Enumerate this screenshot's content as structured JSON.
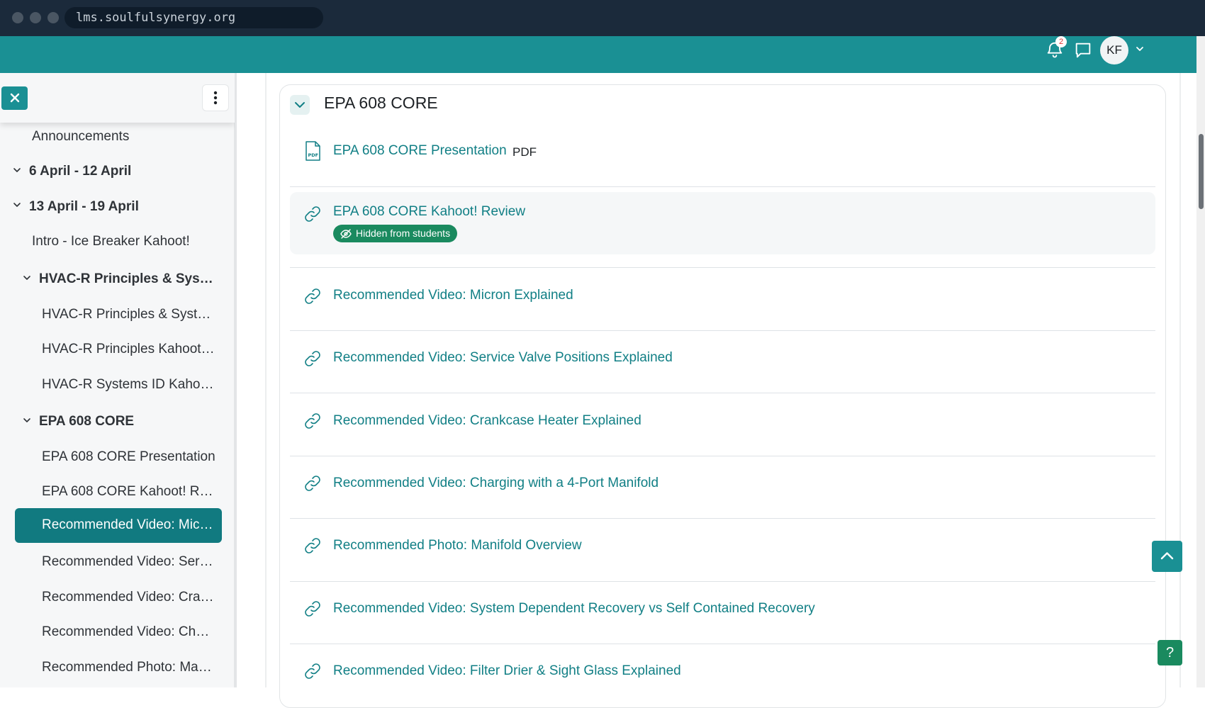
{
  "browser": {
    "url": "lms.soulfulsynergy.org"
  },
  "topbar": {
    "notification_count": "2",
    "avatar_initials": "KF",
    "icons": [
      "bell-icon",
      "chat-icon",
      "chevron-down-icon"
    ]
  },
  "sidebar": {
    "items": [
      {
        "label": "Announcements",
        "kind": "item"
      },
      {
        "label": "6 April - 12 April",
        "kind": "section"
      },
      {
        "label": "13 April - 19 April",
        "kind": "section"
      },
      {
        "label": "Intro - Ice Breaker Kahoot!",
        "kind": "item"
      },
      {
        "label": "HVAC-R Principles & Sys…",
        "kind": "subsection"
      },
      {
        "label": "HVAC-R Principles & Syst…",
        "kind": "item"
      },
      {
        "label": "HVAC-R Principles Kahoot…",
        "kind": "item"
      },
      {
        "label": "HVAC-R Systems ID Kaho…",
        "kind": "item"
      },
      {
        "label": "EPA 608 CORE",
        "kind": "subsection"
      },
      {
        "label": "EPA 608 CORE Presentation",
        "kind": "item"
      },
      {
        "label": "EPA 608 CORE Kahoot! R…",
        "kind": "item"
      },
      {
        "label": "Recommended Video: Mic…",
        "kind": "item",
        "active": true
      },
      {
        "label": "Recommended Video: Ser…",
        "kind": "item"
      },
      {
        "label": "Recommended Video: Cra…",
        "kind": "item"
      },
      {
        "label": "Recommended Video: Ch…",
        "kind": "item"
      },
      {
        "label": "Recommended Photo: Ma…",
        "kind": "item"
      }
    ]
  },
  "main": {
    "section_title": "EPA 608 CORE",
    "activities": [
      {
        "title": "EPA 608 CORE Presentation",
        "type_label": "PDF",
        "icon": "pdf-icon"
      },
      {
        "title": "EPA 608 CORE Kahoot! Review",
        "icon": "link-icon",
        "badge": "Hidden from students"
      },
      {
        "title": "Recommended Video: Micron Explained",
        "icon": "link-icon"
      },
      {
        "title": "Recommended Video: Service Valve Positions Explained",
        "icon": "link-icon"
      },
      {
        "title": "Recommended Video: Crankcase Heater Explained",
        "icon": "link-icon"
      },
      {
        "title": "Recommended Video: Charging with a 4-Port Manifold",
        "icon": "link-icon"
      },
      {
        "title": "Recommended Photo: Manifold Overview",
        "icon": "link-icon"
      },
      {
        "title": "Recommended Video: System Dependent Recovery vs Self Contained Recovery",
        "icon": "link-icon"
      },
      {
        "title": "Recommended Video: Filter Drier & Sight Glass Explained",
        "icon": "link-icon"
      }
    ]
  },
  "buttons": {
    "help_label": "?"
  },
  "colors": {
    "brand": "#1a9094",
    "active_nav": "#117a80",
    "link": "#117f85",
    "badge": "#1a8a5f"
  }
}
